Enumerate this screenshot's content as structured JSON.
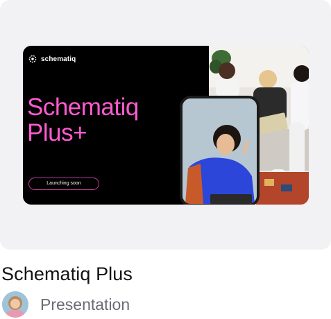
{
  "design": {
    "brand": "schematiq",
    "headline": "Schematiq Plus+",
    "pill": "Launching soon",
    "title": "Schematiq Plus",
    "type": "Presentation"
  },
  "colors": {
    "card_bg": "#f2f2f4",
    "headline": "#ff5ad1",
    "title": "#121212",
    "subtitle": "#6b6b75"
  }
}
